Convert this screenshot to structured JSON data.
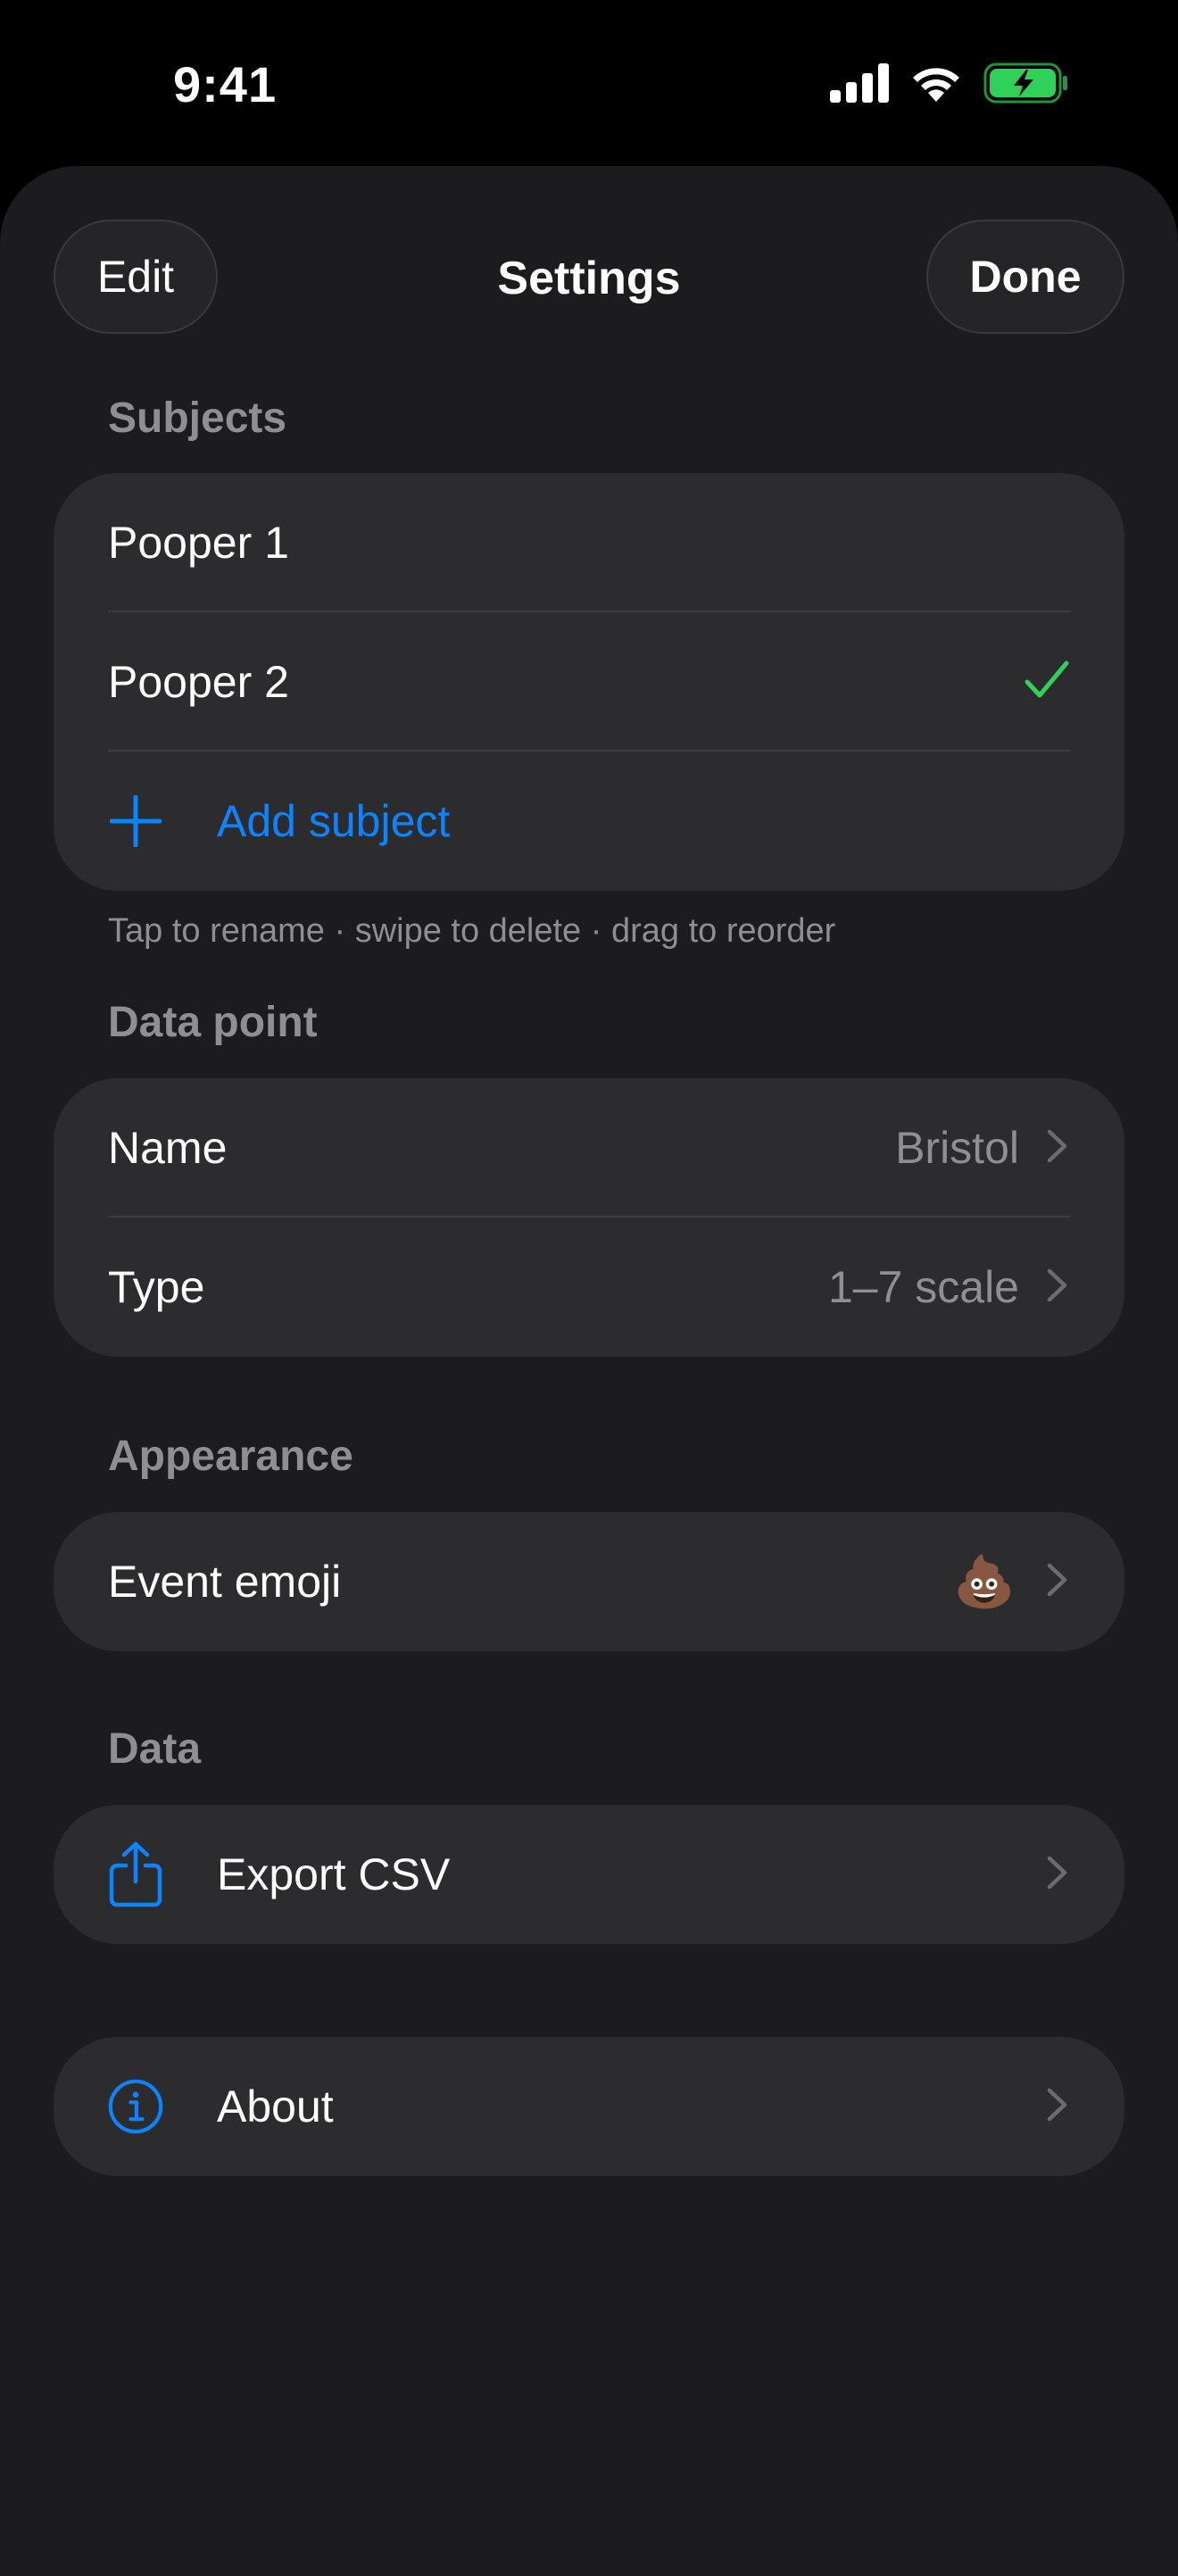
{
  "status_bar": {
    "time": "9:41",
    "icons": [
      "cellular-signal-icon",
      "wifi-icon",
      "battery-charging-icon"
    ],
    "battery_color": "#30d158"
  },
  "nav": {
    "title": "Settings",
    "edit_label": "Edit",
    "done_label": "Done"
  },
  "subjects": {
    "header": "Subjects",
    "items": [
      {
        "label": "Pooper 1",
        "selected": false
      },
      {
        "label": "Pooper 2",
        "selected": true
      }
    ],
    "add_label": "Add subject",
    "footnote": "Tap to rename · swipe to delete · drag to reorder"
  },
  "data_point": {
    "header": "Data point",
    "name_label": "Name",
    "name_value": "Bristol",
    "type_label": "Type",
    "type_value": "1–7 scale"
  },
  "appearance": {
    "header": "Appearance",
    "emoji_label": "Event emoji",
    "emoji_value": "💩"
  },
  "data": {
    "header": "Data",
    "export_label": "Export CSV"
  },
  "about": {
    "label": "About"
  },
  "colors": {
    "accent": "#0a84ff",
    "check": "#30d158",
    "background": "#1c1c1e",
    "cell": "#2c2c2e",
    "secondary_text": "#8e8e93"
  }
}
